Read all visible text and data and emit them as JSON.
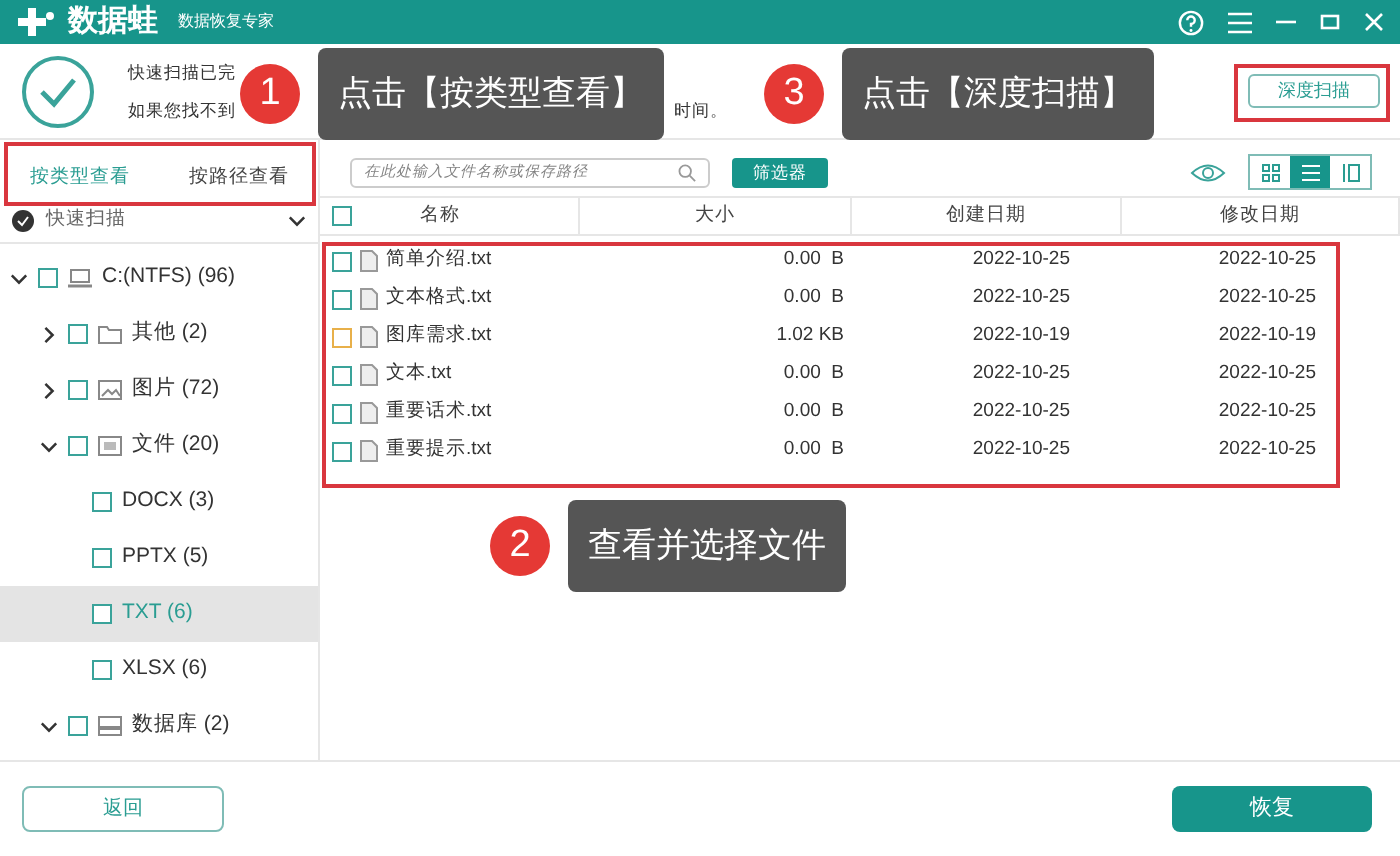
{
  "app": {
    "name": "数据蛙",
    "subtitle": "数据恢复专家"
  },
  "status": {
    "line_1": "快速扫描已完",
    "line_2_start": "如果您找不到",
    "line_2_end": "时间。"
  },
  "deep_scan_button": "深度扫描",
  "view_tabs": [
    {
      "label": "按类型查看",
      "selected": true
    },
    {
      "label": "按路径查看",
      "selected": false
    }
  ],
  "scan_selector": {
    "label": "快速扫描"
  },
  "tree": [
    {
      "label": "C:(NTFS) (96)",
      "kind": "drive",
      "expanded": true,
      "selected": false,
      "children": [
        {
          "label": "其他 (2)",
          "kind": "folder",
          "expanded": false,
          "selected": false
        },
        {
          "label": "图片 (72)",
          "kind": "image",
          "expanded": false,
          "selected": false
        },
        {
          "label": "文件 (20)",
          "kind": "document",
          "expanded": true,
          "selected": false,
          "children": [
            {
              "label": "DOCX (3)",
              "selected": false
            },
            {
              "label": "PPTX (5)",
              "selected": false
            },
            {
              "label": "TXT (6)",
              "selected": true
            },
            {
              "label": "XLSX (6)",
              "selected": false
            }
          ]
        },
        {
          "label": "数据库 (2)",
          "kind": "database",
          "expanded": true,
          "selected": false
        }
      ]
    }
  ],
  "search": {
    "placeholder": "在此处输入文件名称或保存路径"
  },
  "filter_button": "筛选器",
  "view_modes": [
    {
      "kind": "grid",
      "selected": false
    },
    {
      "kind": "list",
      "selected": true
    },
    {
      "kind": "detail",
      "selected": false
    }
  ],
  "table": {
    "select_all": {
      "checked": false
    },
    "columns": [
      "名称",
      "大小",
      "创建日期",
      "修改日期"
    ],
    "rows": [
      {
        "name": "简单介绍.txt",
        "size": "0.00  B",
        "created": "2022-10-25",
        "modified": "2022-10-25",
        "color": "#3aa39a"
      },
      {
        "name": "文本格式.txt",
        "size": "0.00  B",
        "created": "2022-10-25",
        "modified": "2022-10-25",
        "color": "#3aa39a"
      },
      {
        "name": "图库需求.txt",
        "size": "1.02 KB",
        "created": "2022-10-19",
        "modified": "2022-10-19",
        "color": "#e8b04a"
      },
      {
        "name": "文本.txt",
        "size": "0.00  B",
        "created": "2022-10-25",
        "modified": "2022-10-25",
        "color": "#3aa39a"
      },
      {
        "name": "重要话术.txt",
        "size": "0.00  B",
        "created": "2022-10-25",
        "modified": "2022-10-25",
        "color": "#3aa39a"
      },
      {
        "name": "重要提示.txt",
        "size": "0.00  B",
        "created": "2022-10-25",
        "modified": "2022-10-25",
        "color": "#3aa39a"
      }
    ]
  },
  "footer": {
    "back_button": "返回",
    "recover_button": "恢复"
  },
  "annotations": [
    {
      "number": "1",
      "text": "点击【按类型查看】"
    },
    {
      "number": "3",
      "text": "点击【深度扫描】"
    },
    {
      "number": "2",
      "text": "查看并选择文件"
    }
  ]
}
